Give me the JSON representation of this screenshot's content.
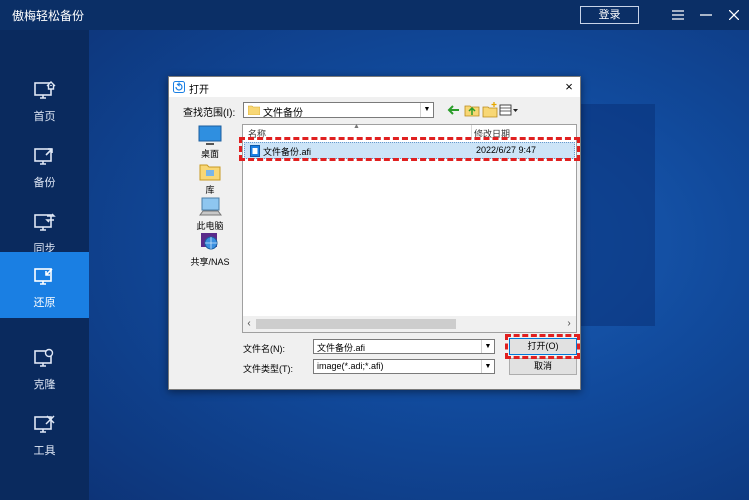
{
  "app": {
    "title": "傲梅轻松备份",
    "login_label": "登录",
    "menu_icon": "menu-icon",
    "minimize_icon": "minimize-icon",
    "close_icon": "close-icon"
  },
  "sidebar": {
    "items": [
      {
        "label": "首页",
        "icon": "home-icon",
        "active": false
      },
      {
        "label": "备份",
        "icon": "backup-icon",
        "active": false
      },
      {
        "label": "同步",
        "icon": "sync-icon",
        "active": false
      },
      {
        "label": "还原",
        "icon": "restore-icon",
        "active": true
      },
      {
        "label": "克隆",
        "icon": "clone-icon",
        "active": false
      },
      {
        "label": "工具",
        "icon": "tools-icon",
        "active": false
      }
    ]
  },
  "dialog": {
    "title": "打开",
    "close_glyph": "×",
    "look_in_label": "查找范围(I):",
    "look_in_value": "文件备份",
    "places": [
      {
        "label": "桌面",
        "icon": "desktop-icon"
      },
      {
        "label": "库",
        "icon": "library-icon"
      },
      {
        "label": "此电脑",
        "icon": "computer-icon"
      },
      {
        "label": "共享/NAS",
        "icon": "network-share-icon"
      }
    ],
    "columns": {
      "name": "名称",
      "modified": "修改日期"
    },
    "files": [
      {
        "name": "文件备份.afi",
        "modified": "2022/6/27 9:47",
        "selected": true
      }
    ],
    "filename_label": "文件名(N):",
    "filename_value": "文件备份.afi",
    "filetype_label": "文件类型(T):",
    "filetype_value": "image(*.adi;*.afi)",
    "open_button": "打开(O)",
    "cancel_button": "取消"
  },
  "colors": {
    "accent_active": "#1a7fe3",
    "highlight_box": "#e02020",
    "sidebar_bg": "#0a2a5e",
    "selection_bg": "#cce4f7"
  }
}
